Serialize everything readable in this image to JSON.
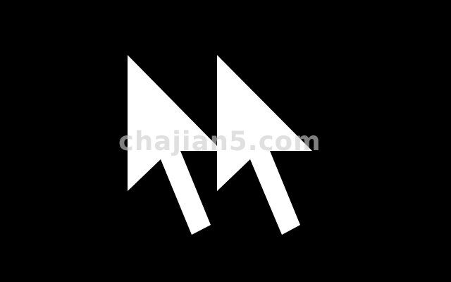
{
  "background_color": "#000000",
  "cursor_color": "#ffffff",
  "icons": [
    "cursor-arrow-icon",
    "cursor-arrow-icon"
  ],
  "watermark": {
    "text": "chajian5.com"
  }
}
